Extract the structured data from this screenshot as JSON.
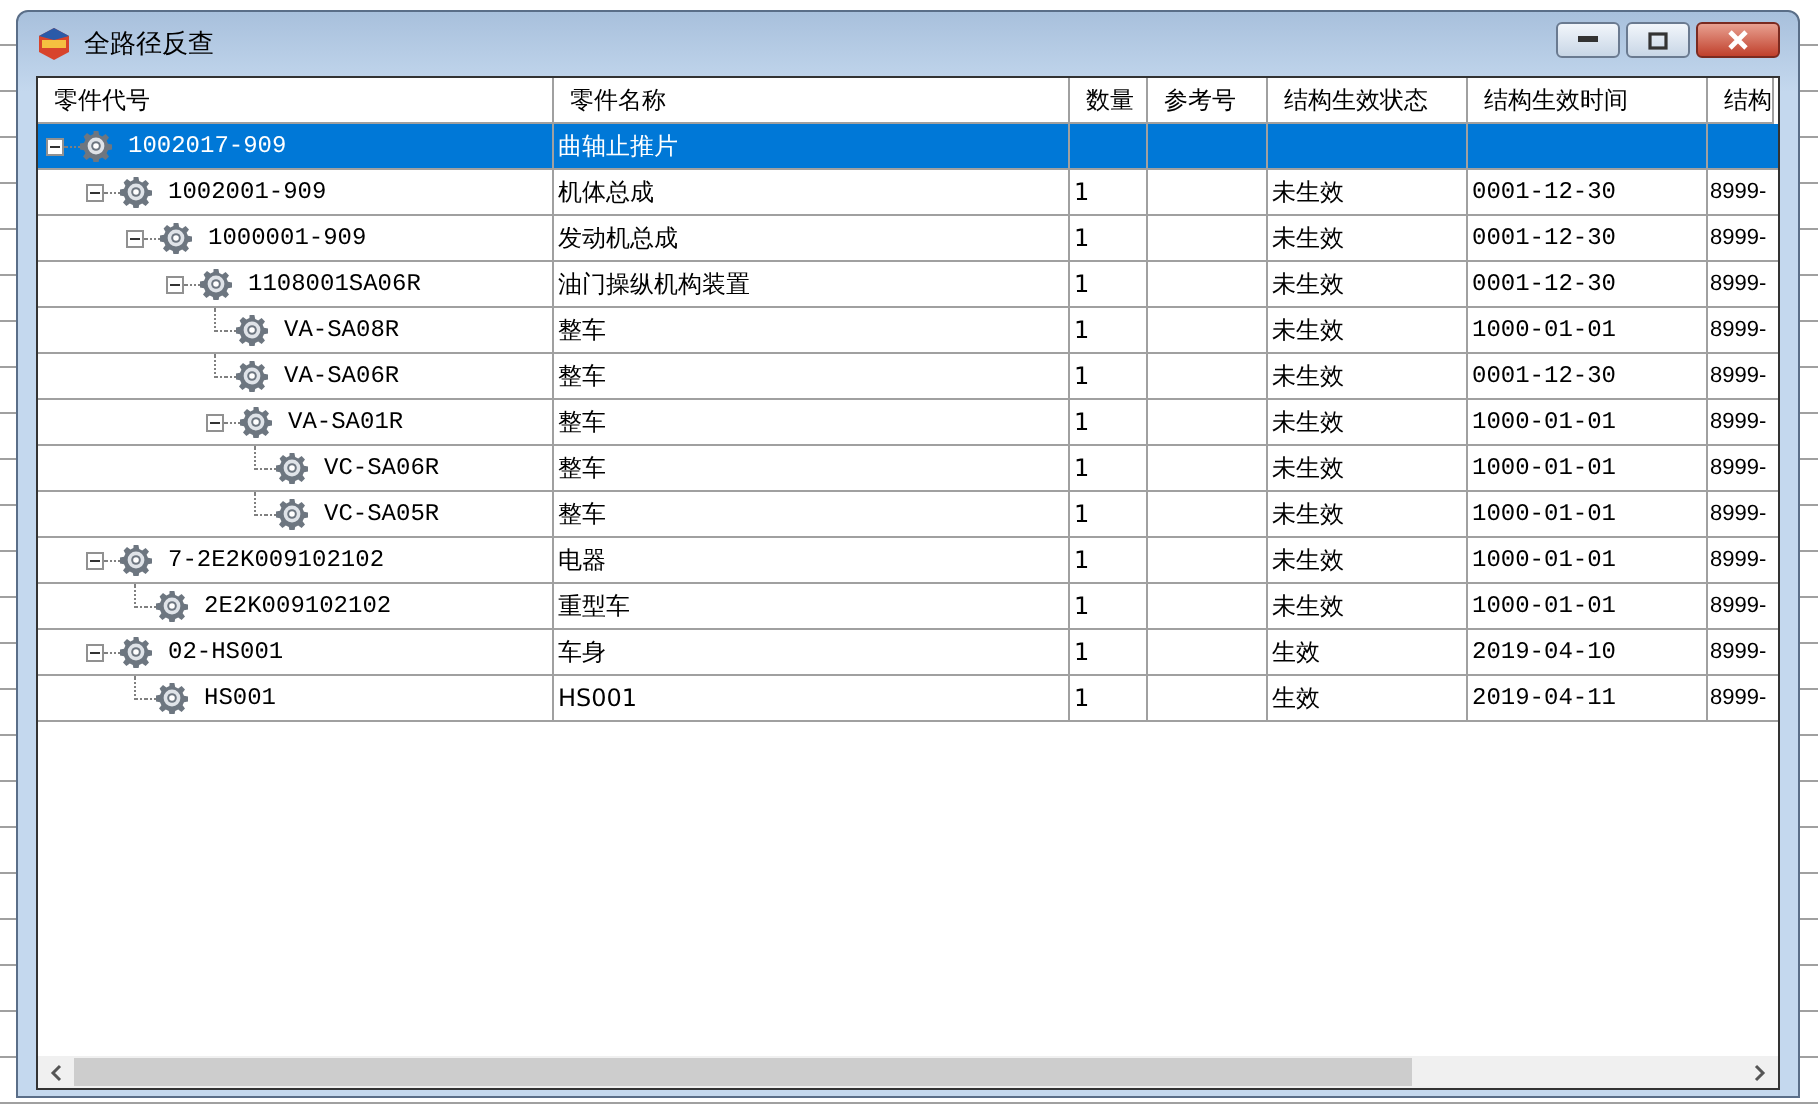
{
  "window": {
    "title": "全路径反查"
  },
  "tree": {
    "columns": [
      "零件代号",
      "零件名称",
      "数量",
      "参考号",
      "结构生效状态",
      "结构生效时间",
      "结构"
    ],
    "rows": [
      {
        "code": "1002017-909",
        "name": "曲轴止推片",
        "selected": true,
        "expanded": true,
        "children": [
          {
            "code": "1002001-909",
            "name": "机体总成",
            "qty": "1",
            "status": "未生效",
            "start": "0001-12-30",
            "end": "8999-",
            "selected": false,
            "expanded": true,
            "children": [
              {
                "code": "1000001-909",
                "name": "发动机总成",
                "qty": "1",
                "status": "未生效",
                "start": "0001-12-30",
                "end": "8999-",
                "selected": false,
                "expanded": true,
                "children": [
                  {
                    "code": "1108001SA06R",
                    "name": "油门操纵机构装置",
                    "qty": "1",
                    "status": "未生效",
                    "start": "0001-12-30",
                    "end": "8999-",
                    "selected": false,
                    "expanded": true,
                    "children": [
                      {
                        "code": "VA-SA08R",
                        "name": "整车",
                        "qty": "1",
                        "status": "未生效",
                        "start": "1000-01-01",
                        "end": "8999-",
                        "selected": false
                      },
                      {
                        "code": "VA-SA06R",
                        "name": "整车",
                        "qty": "1",
                        "status": "未生效",
                        "start": "0001-12-30",
                        "end": "8999-",
                        "selected": false
                      },
                      {
                        "code": "VA-SA01R",
                        "name": "整车",
                        "qty": "1",
                        "status": "未生效",
                        "start": "1000-01-01",
                        "end": "8999-",
                        "selected": false,
                        "expanded": true,
                        "children": [
                          {
                            "code": "VC-SA06R",
                            "name": "整车",
                            "qty": "1",
                            "status": "未生效",
                            "start": "1000-01-01",
                            "end": "8999-",
                            "selected": false
                          },
                          {
                            "code": "VC-SA05R",
                            "name": "整车",
                            "qty": "1",
                            "status": "未生效",
                            "start": "1000-01-01",
                            "end": "8999-",
                            "selected": false
                          }
                        ]
                      }
                    ]
                  }
                ]
              }
            ]
          },
          {
            "code": "7-2E2K009102102",
            "name": "电器",
            "qty": "1",
            "status": "未生效",
            "start": "1000-01-01",
            "end": "8999-",
            "selected": false,
            "expanded": true,
            "children": [
              {
                "code": "2E2K009102102",
                "name": "重型车",
                "qty": "1",
                "status": "未生效",
                "start": "1000-01-01",
                "end": "8999-",
                "selected": false
              }
            ]
          },
          {
            "code": "02-HS001",
            "name": "车身",
            "qty": "1",
            "status": "生效",
            "start": "2019-04-10",
            "end": "8999-",
            "selected": false,
            "expanded": true,
            "children": [
              {
                "code": "HS001",
                "name": "HS001",
                "qty": "1",
                "status": "生效",
                "start": "2019-04-11",
                "end": "8999-",
                "selected": false
              }
            ]
          }
        ]
      }
    ]
  }
}
